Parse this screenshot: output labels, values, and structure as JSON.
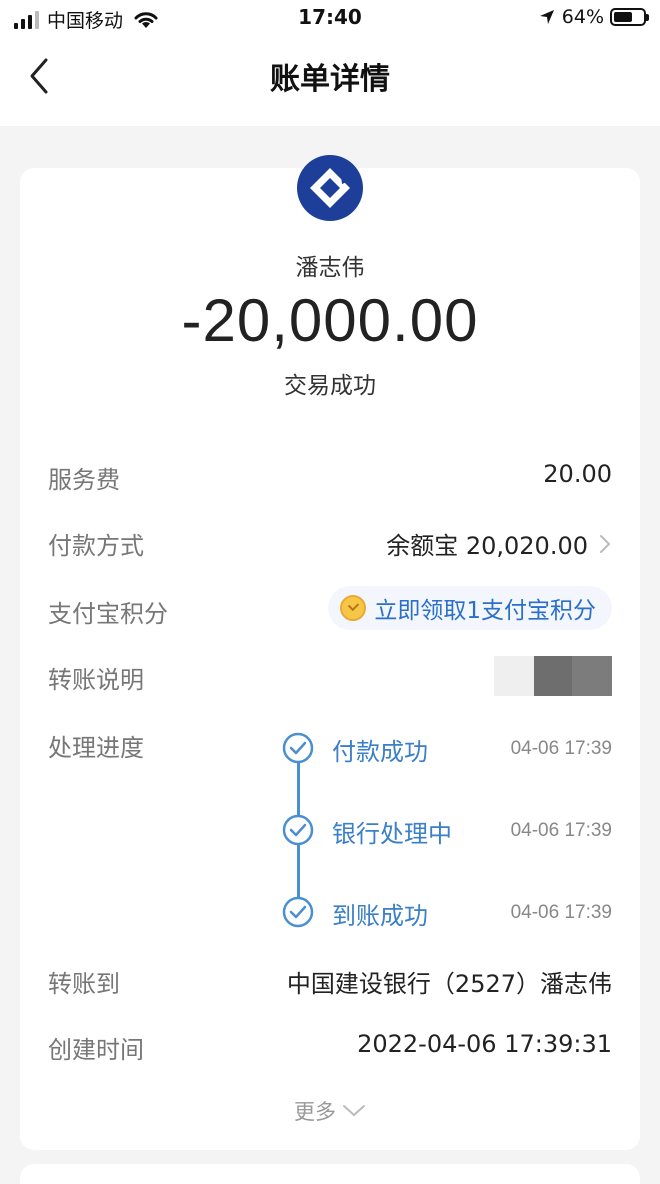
{
  "status_bar": {
    "carrier": "中国移动",
    "time": "17:40",
    "battery": "64%",
    "battery_level": 0.64
  },
  "nav": {
    "title": "账单详情"
  },
  "header": {
    "payee": "潘志伟",
    "amount": "-20,000.00",
    "status": "交易成功"
  },
  "details": {
    "fee": {
      "label": "服务费",
      "value": "20.00"
    },
    "payment_method": {
      "label": "付款方式",
      "value": "余额宝 20,020.00"
    },
    "points": {
      "label": "支付宝积分",
      "value": "立即领取1支付宝积分"
    },
    "memo": {
      "label": "转账说明"
    },
    "progress": {
      "label": "处理进度",
      "steps": [
        {
          "label": "付款成功",
          "time": "04-06 17:39"
        },
        {
          "label": "银行处理中",
          "time": "04-06 17:39"
        },
        {
          "label": "到账成功",
          "time": "04-06 17:39"
        }
      ]
    },
    "transfer_to": {
      "label": "转账到",
      "value": "中国建设银行（2527）潘志伟"
    },
    "created_time": {
      "label": "创建时间",
      "value": "2022-04-06 17:39:31"
    }
  },
  "more": "更多",
  "colors": {
    "bank_logo": "#1d3f99",
    "accent": "#2a6fc9",
    "timeline": "#4a8fd1"
  }
}
